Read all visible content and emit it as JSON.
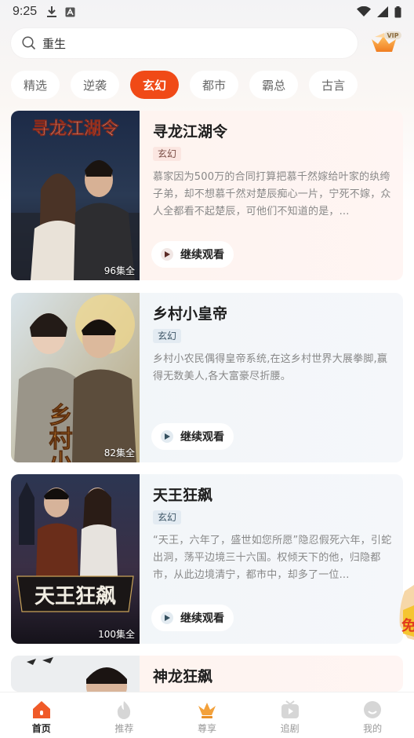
{
  "status_bar": {
    "time": "9:25"
  },
  "search": {
    "query": "重生"
  },
  "categories": [
    {
      "label": "精选"
    },
    {
      "label": "逆袭"
    },
    {
      "label": "玄幻",
      "active": true
    },
    {
      "label": "都市"
    },
    {
      "label": "霸总"
    },
    {
      "label": "古言"
    }
  ],
  "vip_badge": "VIP",
  "dramas": [
    {
      "title": "寻龙江湖令",
      "tag": "玄幻",
      "description": "慕家因为500万的合同打算把慕千然嫁给叶家的纨绔子弟，却不想慕千然对楚辰痴心一片，宁死不嫁，众人全都看不起楚辰，可他们不知道的是，...",
      "episodes": "96集全",
      "cover_text": "寻龙江湖令",
      "button": "继续观看"
    },
    {
      "title": "乡村小皇帝",
      "tag": "玄幻",
      "description": "乡村小农民偶得皇帝系统,在这乡村世界大展拳脚,赢得无数美人,各大富豪尽折腰。",
      "episodes": "82集全",
      "cover_text": "乡村小皇",
      "button": "继续观看"
    },
    {
      "title": "天王狂飙",
      "tag": "玄幻",
      "description": "“天王，六年了，盛世如您所愿”隐忍假死六年，引蛇出洞，荡平边境三十六国。权倾天下的他，归隐都市，从此边境清宁，都市中，却多了一位...",
      "episodes": "100集全",
      "cover_text": "天王狂飙",
      "button": "继续观看"
    },
    {
      "title": "神龙狂飙"
    }
  ],
  "float_badge": "免",
  "bottom_nav": [
    {
      "label": "首页",
      "active": true
    },
    {
      "label": "推荐"
    },
    {
      "label": "尊享"
    },
    {
      "label": "追剧"
    },
    {
      "label": "我的"
    }
  ]
}
